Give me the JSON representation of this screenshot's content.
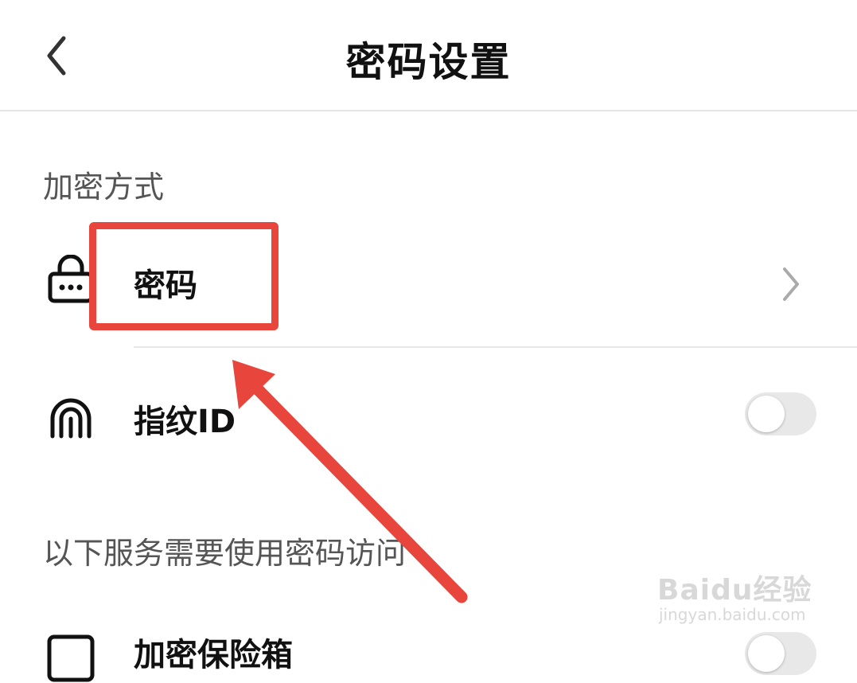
{
  "header": {
    "title": "密码设置",
    "back_icon": "chevron-left-icon"
  },
  "section1": {
    "label": "加密方式"
  },
  "rows": {
    "password": {
      "label": "密码",
      "icon": "lock-icon"
    },
    "fingerprint": {
      "label": "指纹ID",
      "icon": "fingerprint-icon",
      "toggle_on": false
    }
  },
  "section2": {
    "label": "以下服务需要使用密码访问"
  },
  "row3": {
    "label": "加密保险箱",
    "icon": "safe-icon",
    "toggle_on": false
  },
  "annotation": {
    "highlight_color": "#e8453c"
  },
  "watermark": {
    "logo": "Baidu经验",
    "url": "jingyan.baidu.com"
  }
}
